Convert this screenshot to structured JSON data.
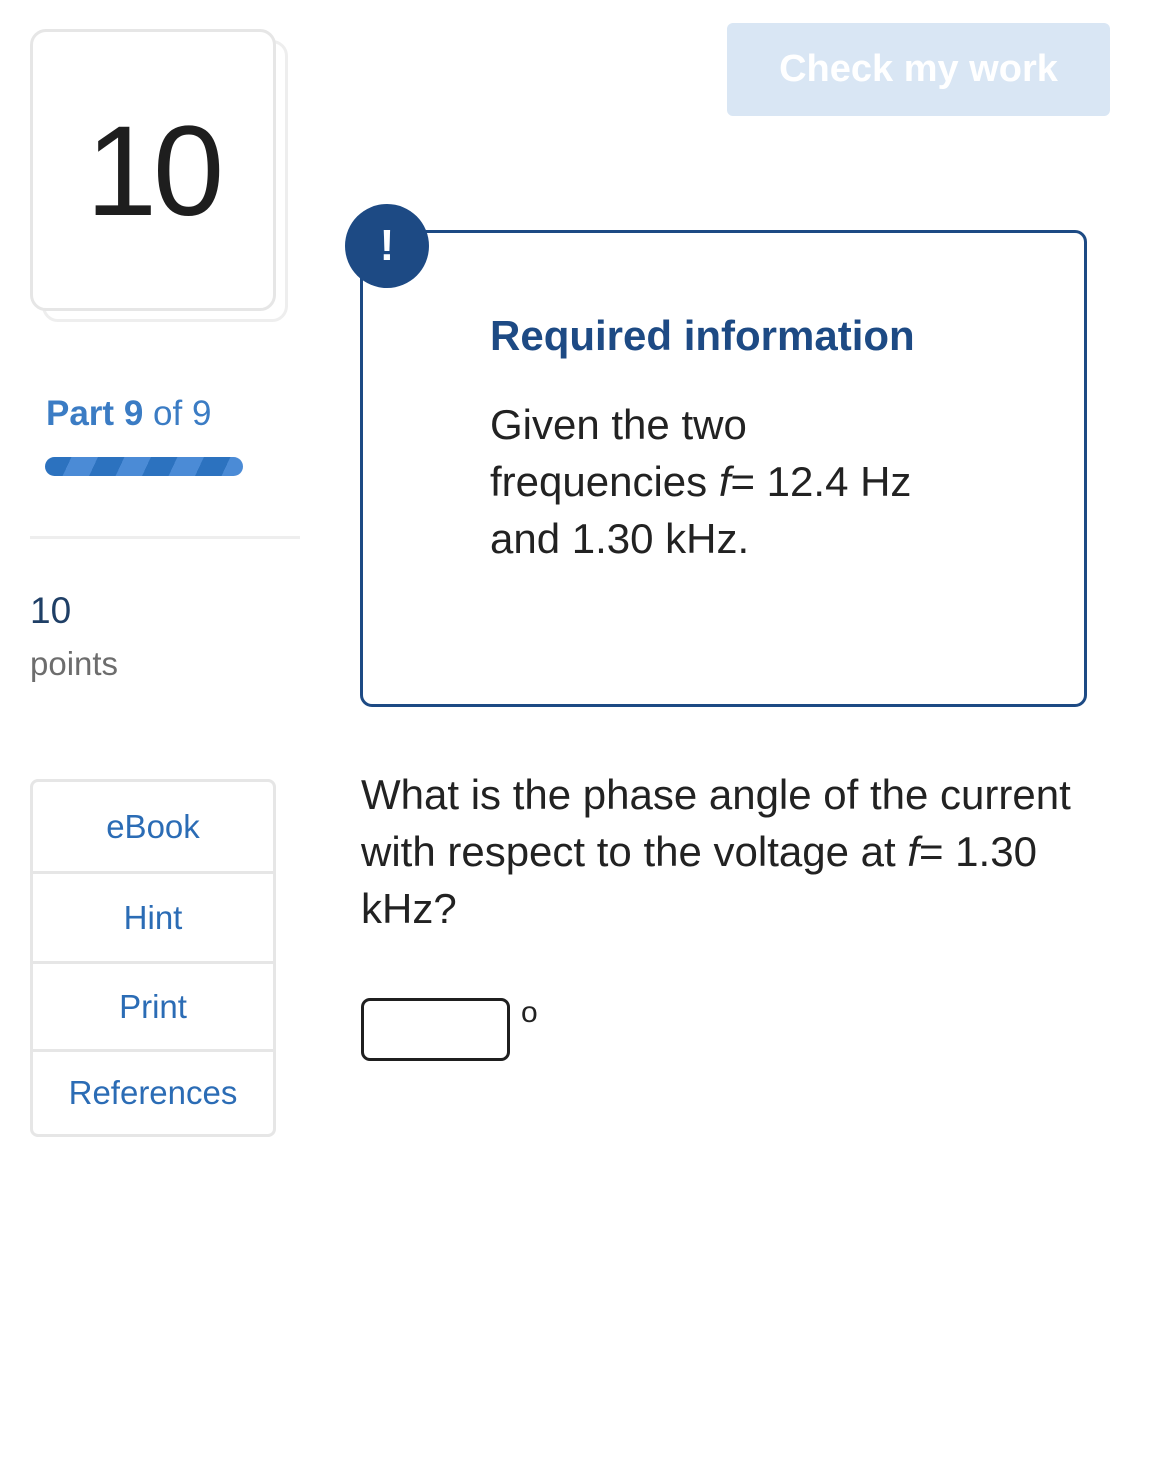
{
  "question_card": {
    "number": "10"
  },
  "part": {
    "word": "Part",
    "current": "9",
    "of_text": "of 9"
  },
  "points": {
    "value": "10",
    "label": "points"
  },
  "resources": {
    "ebook": "eBook",
    "hint": "Hint",
    "print": "Print",
    "references": "References"
  },
  "toolbar": {
    "check_label": "Check my work"
  },
  "required_info": {
    "badge": "!",
    "title": "Required information",
    "text_1": "Given the two frequencies ",
    "var_f": "f",
    "text_2": "= 12.4 Hz and 1.30 kHz."
  },
  "question": {
    "text_1": "What is the phase angle of the current with respect to the voltage at ",
    "var_f": "f",
    "text_2": "= 1.30 kHz?"
  },
  "answer": {
    "value": "",
    "unit": "o"
  },
  "colors": {
    "brand_blue": "#1d4a84",
    "link_blue": "#2b6cb5",
    "disabled_button": "#d9e6f4"
  }
}
